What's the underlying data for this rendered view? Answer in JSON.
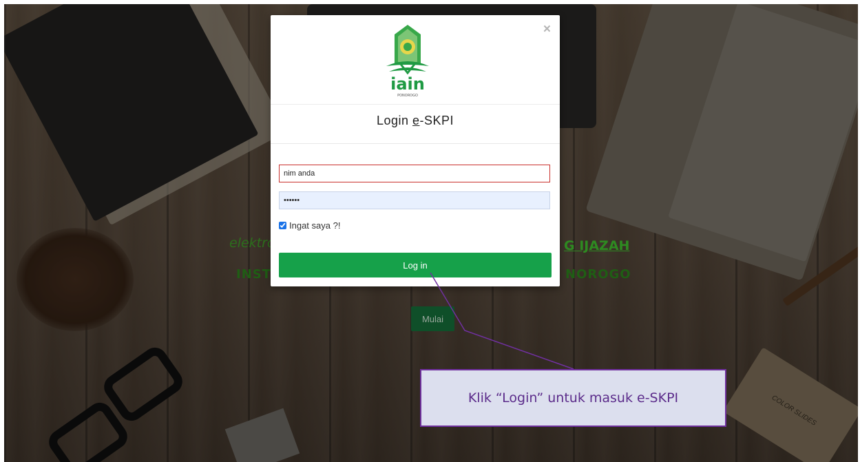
{
  "background": {
    "left_line1": "elektro",
    "right_line1": "G IJAZAH",
    "left_line2": "INST",
    "right_line2": "NOROGO",
    "start_button": "Mulai",
    "box_text": "COLOR SLIDES"
  },
  "modal": {
    "close_icon": "×",
    "logo_text": "iain",
    "logo_subtext": "PONOROGO",
    "title_prefix": "Login ",
    "title_e": "e",
    "title_suffix": "-SKPI",
    "username_value": "nim anda",
    "password_value": "••••••",
    "remember_label": "Ingat saya ?!",
    "login_button": "Log in"
  },
  "callout": {
    "text": "Klik “Login” untuk masuk e-SKPI"
  },
  "colors": {
    "primary_green": "#16a14a",
    "callout_border": "#7030a0",
    "callout_bg": "#dcdfee",
    "error_border": "#c9302c"
  }
}
